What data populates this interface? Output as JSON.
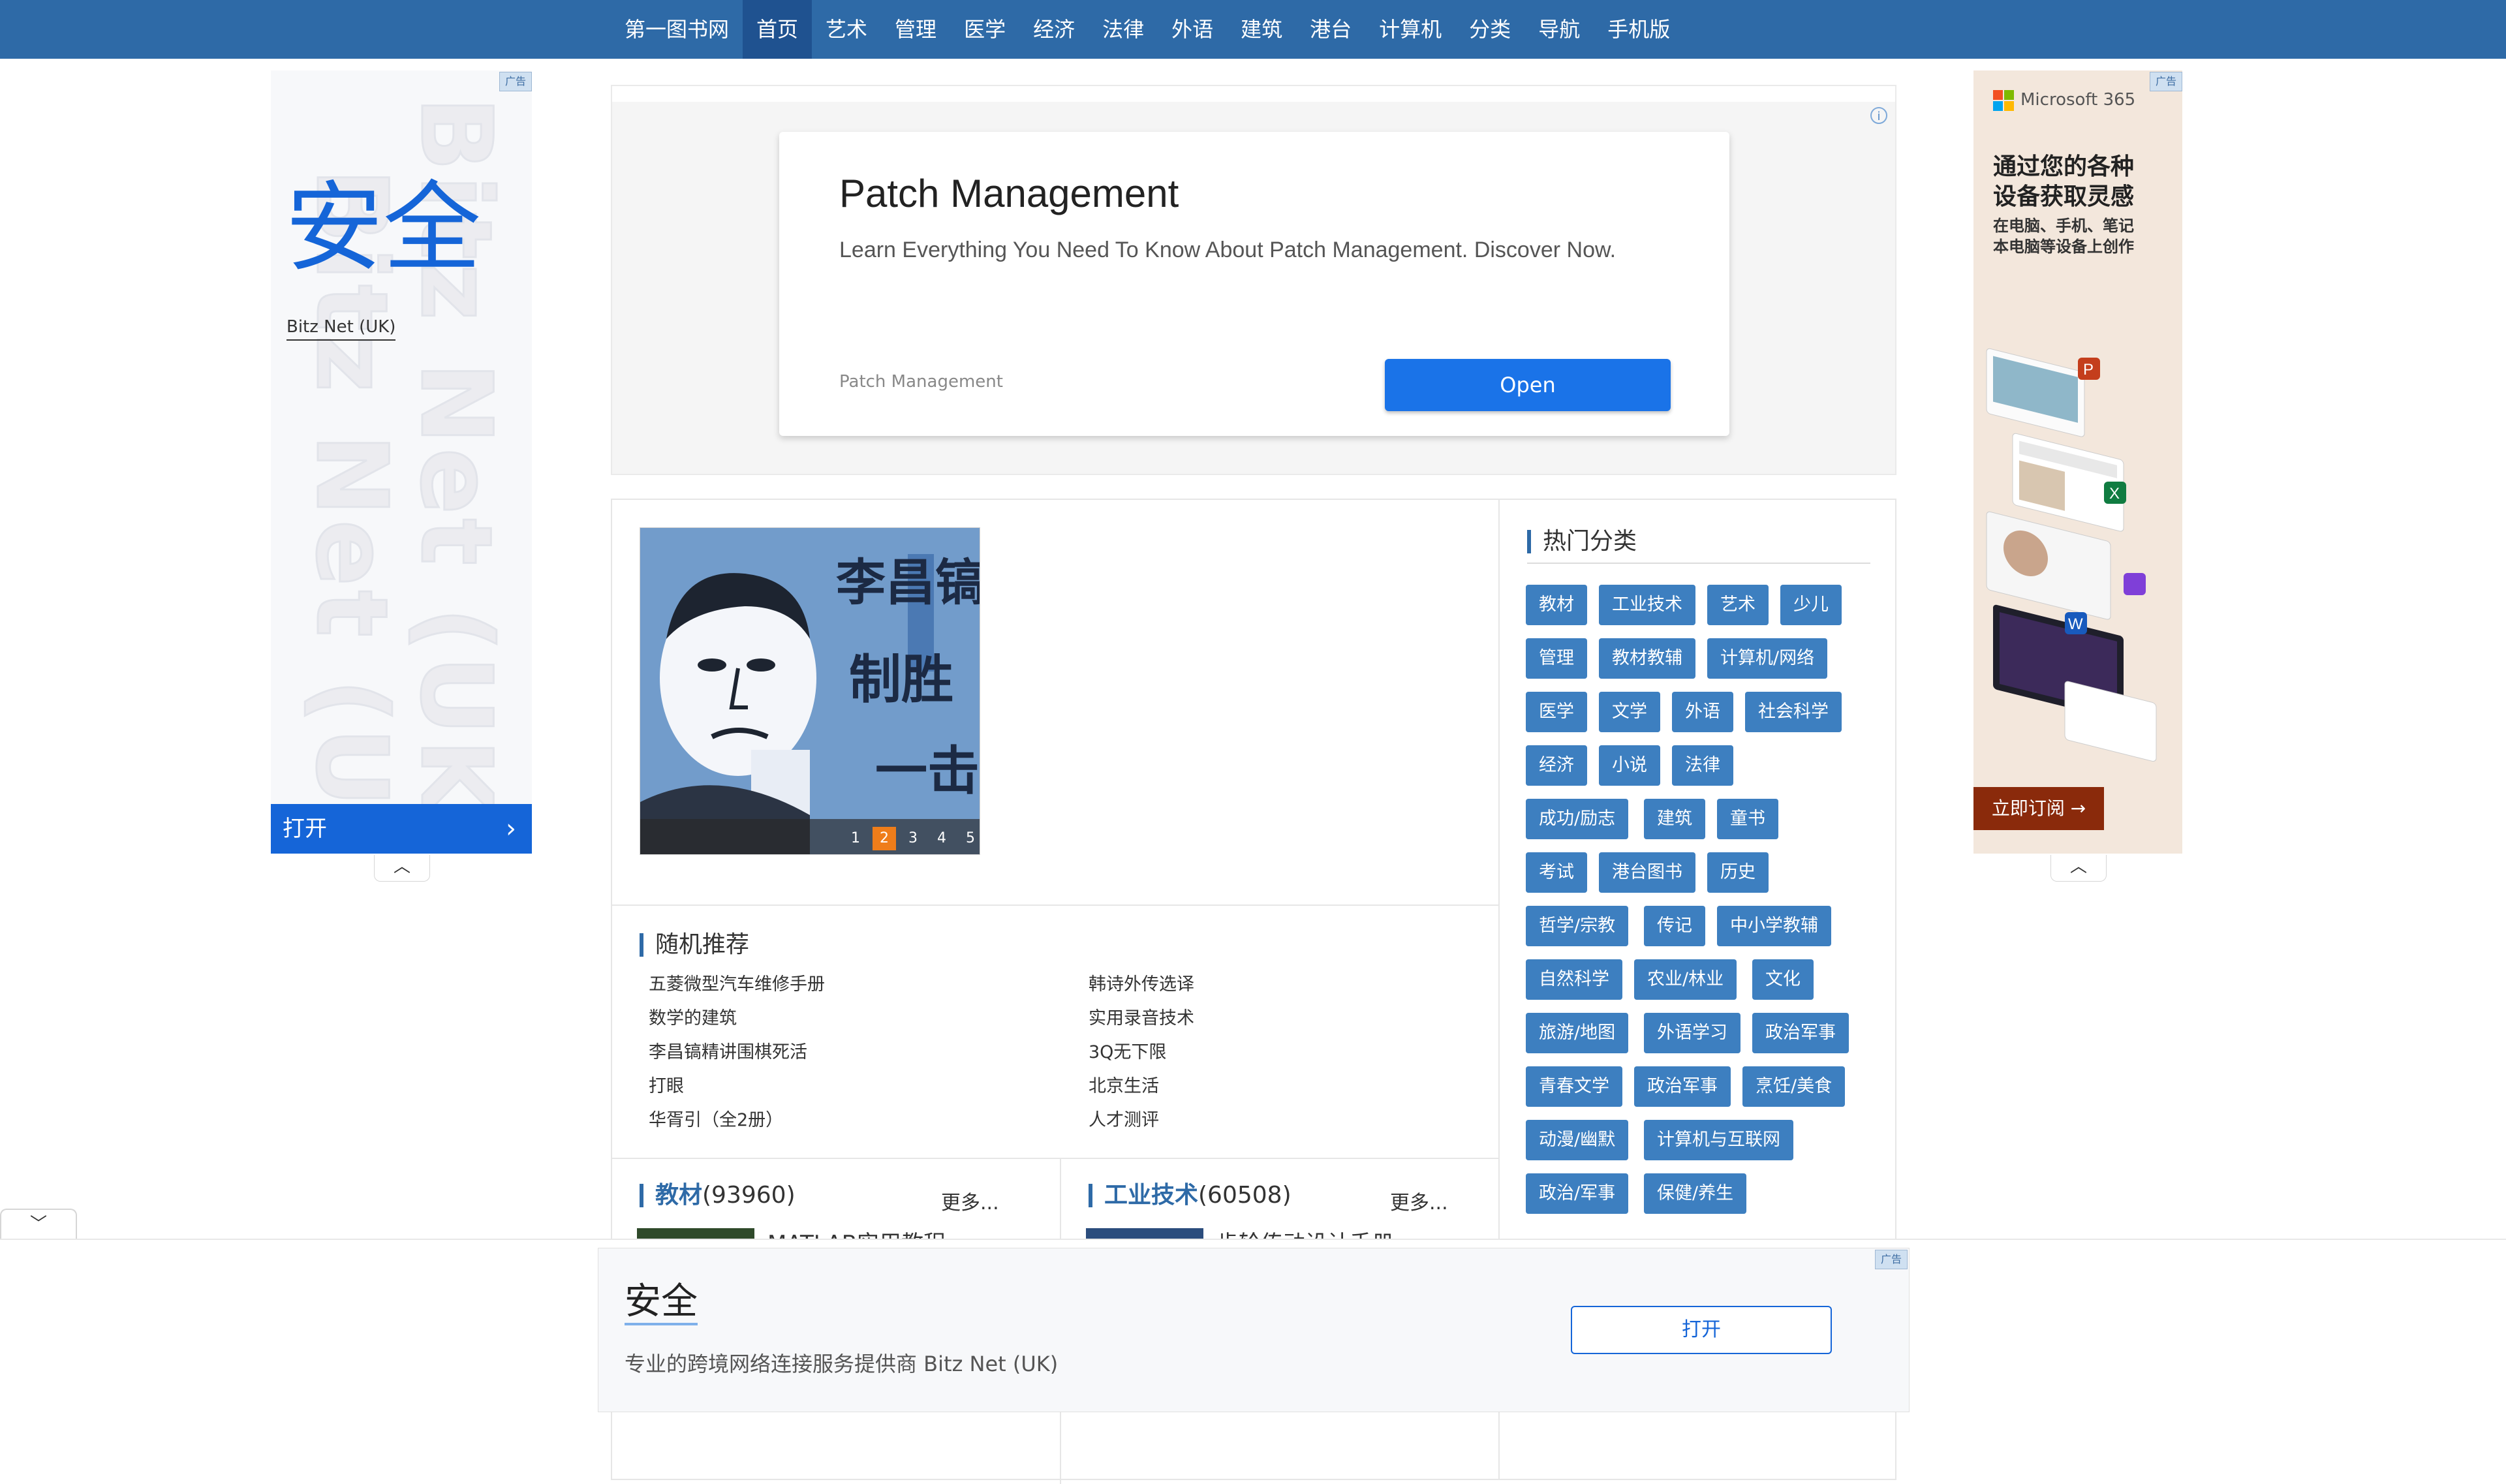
{
  "nav": {
    "items": [
      "第一图书网",
      "首页",
      "艺术",
      "管理",
      "医学",
      "经济",
      "法律",
      "外语",
      "建筑",
      "港台",
      "计算机",
      "分类",
      "导航",
      "手机版"
    ],
    "active_index": 1,
    "bar_color": "#2e6aa7"
  },
  "ad_labels": {
    "tag": "广告",
    "info": "i"
  },
  "left_ad": {
    "headline": "安全",
    "brand": "Bitz Net (UK)",
    "bg_text": "Bitz Net (UK)",
    "open_label": "打开",
    "accent_color": "#1565d8"
  },
  "right_ad": {
    "brand": "Microsoft 365",
    "headline_line1": "通过您的各种",
    "headline_line2": "设备获取灵感",
    "sub_line1": "在电脑、手机、笔记",
    "sub_line2": "本电脑等设备上创作",
    "cta": "立即订阅 →",
    "bg_color": "#f3e7dc"
  },
  "banner_ad": {
    "title": "Patch Management",
    "description": "Learn Everything You Need To Know About Patch Management. Discover Now.",
    "source": "Patch Management",
    "open_label": "Open"
  },
  "slider": {
    "cover_title": "李昌镐制胜一击",
    "pages": [
      "1",
      "2",
      "3",
      "4",
      "5"
    ],
    "active_page_index": 1
  },
  "random_recommend": {
    "title": "随机推荐",
    "left": [
      "五菱微型汽车维修手册",
      "数学的建筑",
      "李昌镐精讲围棋死活",
      "打眼",
      "华胥引（全2册）"
    ],
    "right": [
      "韩诗外传选译",
      "实用录音技术",
      "3Q无下限",
      "北京生活",
      "人才测评"
    ]
  },
  "categories": [
    {
      "name": "教材",
      "count": "(93960)",
      "more": "更多...",
      "first_book": "MATLAB实用教程"
    },
    {
      "name": "工业技术",
      "count": "(60508)",
      "more": "更多...",
      "first_book": "齿轮传动设计手册"
    }
  ],
  "hot": {
    "title": "热门分类",
    "tags": [
      [
        "教材",
        "工业技术",
        "艺术",
        "少儿"
      ],
      [
        "管理",
        "教材教辅",
        "计算机/网络"
      ],
      [
        "医学",
        "文学",
        "外语",
        "社会科学"
      ],
      [
        "经济",
        "小说",
        "法律"
      ],
      [
        "成功/励志",
        "建筑",
        "童书"
      ],
      [
        "考试",
        "港台图书",
        "历史"
      ],
      [
        "哲学/宗教",
        "传记",
        "中小学教辅"
      ],
      [
        "自然科学",
        "农业/林业",
        "文化"
      ],
      [
        "旅游/地图",
        "外语学习",
        "政治军事"
      ],
      [
        "青春文学",
        "政治军事",
        "烹饪/美食"
      ],
      [
        "动漫/幽默",
        "计算机与互联网"
      ],
      [
        "政治/军事",
        "保健/养生"
      ]
    ],
    "tag_color": "#3d7fc0"
  },
  "bottom_ad": {
    "title": "安全",
    "description": "专业的跨境网络连接服务提供商 Bitz Net (UK)",
    "open_label": "打开"
  }
}
